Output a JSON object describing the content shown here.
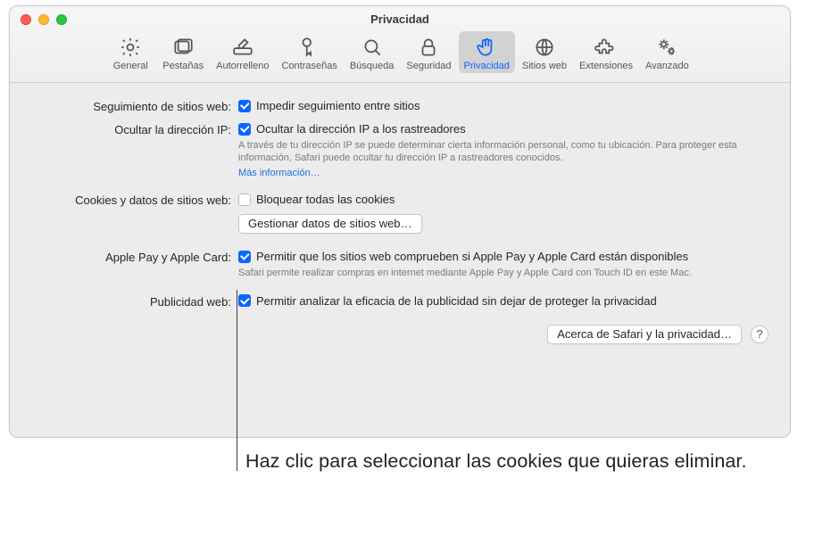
{
  "window": {
    "title": "Privacidad"
  },
  "toolbar": {
    "items": [
      {
        "label": "General"
      },
      {
        "label": "Pestañas"
      },
      {
        "label": "Autorrelleno"
      },
      {
        "label": "Contraseñas"
      },
      {
        "label": "Búsqueda"
      },
      {
        "label": "Seguridad"
      },
      {
        "label": "Privacidad"
      },
      {
        "label": "Sitios web"
      },
      {
        "label": "Extensiones"
      },
      {
        "label": "Avanzado"
      }
    ]
  },
  "sections": {
    "tracking": {
      "label": "Seguimiento de sitios web:",
      "checkbox_label": "Impedir seguimiento entre sitios"
    },
    "hide_ip": {
      "label": "Ocultar la dirección IP:",
      "checkbox_label": "Ocultar la dirección IP a los rastreadores",
      "help": "A través de tu dirección IP se puede determinar cierta información personal, como tu ubicación. Para proteger esta información, Safari puede ocultar tu dirección IP a rastreadores conocidos.",
      "link": "Más información…"
    },
    "cookies": {
      "label": "Cookies y datos de sitios web:",
      "checkbox_label": "Bloquear todas las cookies",
      "manage_btn": "Gestionar datos de sitios web…"
    },
    "apple_pay": {
      "label": "Apple Pay y Apple Card:",
      "checkbox_label": "Permitir que los sitios web comprueben si Apple Pay y Apple Card están disponibles",
      "help": "Safari permite realizar compras en internet mediante Apple Pay y Apple Card con Touch ID en este Mac."
    },
    "web_ads": {
      "label": "Publicidad web:",
      "checkbox_label": "Permitir analizar la eficacia de la publicidad sin dejar de proteger la privacidad"
    },
    "footer": {
      "about_btn": "Acerca de Safari y la privacidad…",
      "help_btn": "?"
    }
  },
  "callout": {
    "text": "Haz clic para seleccionar las cookies que quieras eliminar."
  }
}
